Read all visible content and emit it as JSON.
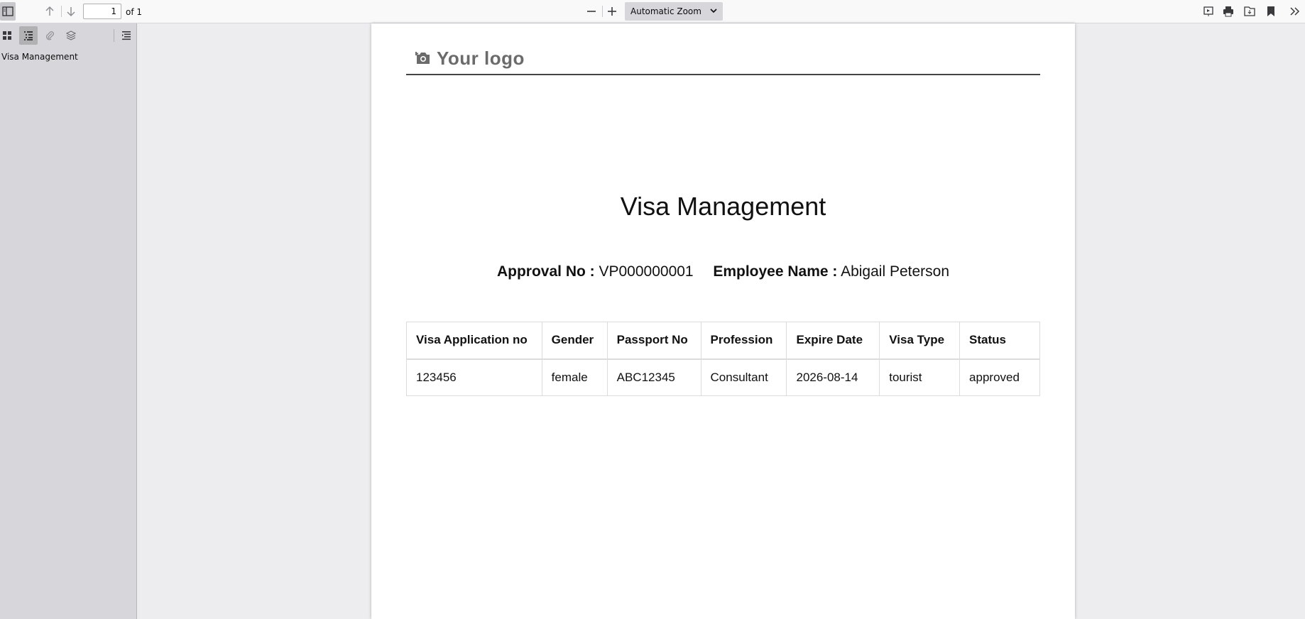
{
  "toolbar": {
    "page_number": "1",
    "page_count": "of 1",
    "zoom": "Automatic Zoom",
    "icons": [
      "sidebar-toggle-icon",
      "arrow-up-icon",
      "arrow-down-icon",
      "minus-icon",
      "plus-icon",
      "chevron-down-icon",
      "presentation-icon",
      "print-icon",
      "save-icon",
      "bookmark-icon",
      "double-chevron-right-icon"
    ]
  },
  "sidebar": {
    "icons": [
      "thumbnails-icon",
      "outline-icon",
      "attachments-icon",
      "layers-icon",
      "current-outline-icon"
    ],
    "outline_items": [
      {
        "label": "Visa Management"
      }
    ]
  },
  "document": {
    "logo_text": "Your logo",
    "title": "Visa Management",
    "approval_label": "Approval No :",
    "approval_value": "VP000000001",
    "employee_label": "Employee Name :",
    "employee_value": "Abigail Peterson",
    "table": {
      "headers": [
        "Visa Application no",
        "Gender",
        "Passport No",
        "Profession",
        "Expire Date",
        "Visa Type",
        "Status"
      ],
      "rows": [
        [
          "123456",
          "female",
          "ABC12345",
          "Consultant",
          "2026-08-14",
          "tourist",
          "approved"
        ]
      ]
    }
  }
}
